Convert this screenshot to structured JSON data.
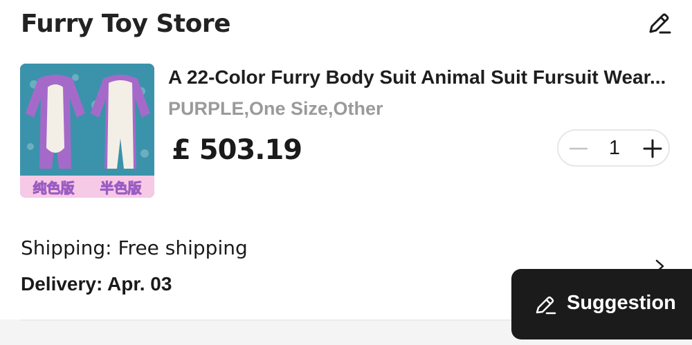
{
  "store": {
    "name": "Furry Toy Store",
    "edit_icon": "pencil-icon"
  },
  "product": {
    "title": "A 22-Color Furry Body Suit Animal Suit Fursuit Wear...",
    "variant": "PURPLE,One Size,Other",
    "price": "£ 503.19",
    "image_caption_left": "纯色版",
    "image_caption_right": "半色版",
    "quantity": "1"
  },
  "shipping": {
    "shipping_text": "Shipping: Free shipping",
    "delivery_text": "Delivery: Apr. 03"
  },
  "suggestion": {
    "label": "Suggestion",
    "icon": "pencil-icon"
  },
  "colors": {
    "text": "#1a1a1a",
    "muted": "#9a9a9a",
    "suggestion_bg": "#1b1b1b",
    "suit_purple": "#9b5cc2"
  }
}
